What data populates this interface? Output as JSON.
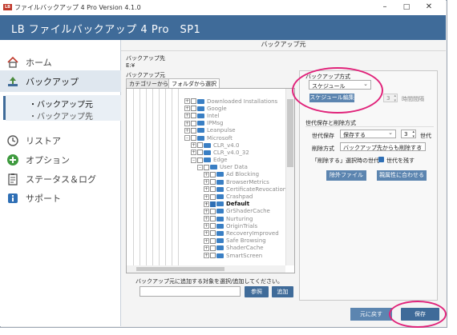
{
  "titlebar": {
    "title": "ファイルバックアップ 4 Pro Version 4.1.0",
    "logo_text": "LB",
    "min": "–",
    "max": "□",
    "close": "✕"
  },
  "header": {
    "title": "LB ファイルバックアップ 4 Pro　SP1"
  },
  "sidebar": {
    "home": "ホーム",
    "backup": "バックアップ",
    "sub_source": "・バックアップ元",
    "sub_dest": "・バックアップ先",
    "restore": "リストア",
    "options": "オプション",
    "status": "ステータス＆ログ",
    "support": "サポート"
  },
  "page": {
    "title": "バックアップ元"
  },
  "dest": {
    "label": "バックアップ先",
    "value": "E:¥"
  },
  "source": {
    "label": "バックアップ元",
    "tab_category": "カテゴリーから選択",
    "tab_folder": "フォルダから選択",
    "add_prompt": "バックアップ元に追加する対象を選択/追加してください。",
    "browse_button": "参照",
    "add_button": "追加"
  },
  "tree": [
    {
      "label": "Downloaded Installations",
      "level": 0,
      "toggle": "+",
      "checked": false
    },
    {
      "label": "Google",
      "level": 0,
      "toggle": "+",
      "checked": false
    },
    {
      "label": "Intel",
      "level": 0,
      "toggle": "+",
      "checked": false
    },
    {
      "label": "IPMsg",
      "level": 0,
      "toggle": "+",
      "checked": false
    },
    {
      "label": "Leanpulse",
      "level": 0,
      "toggle": "+",
      "checked": false
    },
    {
      "label": "Microsoft",
      "level": 0,
      "toggle": "–",
      "checked": false
    },
    {
      "label": "CLR_v4.0",
      "level": 1,
      "toggle": "+",
      "checked": false
    },
    {
      "label": "CLR_v4.0_32",
      "level": 1,
      "toggle": "+",
      "checked": false
    },
    {
      "label": "Edge",
      "level": 1,
      "toggle": "–",
      "checked": false
    },
    {
      "label": "User Data",
      "level": 2,
      "toggle": "–",
      "checked": false
    },
    {
      "label": "Ad Blocking",
      "level": 3,
      "toggle": "+",
      "checked": false
    },
    {
      "label": "BrowserMetrics",
      "level": 3,
      "toggle": "+",
      "checked": false
    },
    {
      "label": "CertificateRevocation",
      "level": 3,
      "toggle": "+",
      "checked": false
    },
    {
      "label": "Crashpad",
      "level": 3,
      "toggle": "+",
      "checked": false
    },
    {
      "label": "Default",
      "level": 3,
      "toggle": "+",
      "checked": true,
      "selected": true
    },
    {
      "label": "GrShaderCache",
      "level": 3,
      "toggle": "+",
      "checked": false
    },
    {
      "label": "Nurturing",
      "level": 3,
      "toggle": "+",
      "checked": false
    },
    {
      "label": "OriginTrials",
      "level": 3,
      "toggle": "+",
      "checked": false
    },
    {
      "label": "RecoveryImproved",
      "level": 3,
      "toggle": "+",
      "checked": false
    },
    {
      "label": "Safe Browsing",
      "level": 3,
      "toggle": "+",
      "checked": false
    },
    {
      "label": "ShaderCache",
      "level": 3,
      "toggle": "+",
      "checked": false
    },
    {
      "label": "SmartScreen",
      "level": 3,
      "toggle": "+",
      "checked": false
    }
  ],
  "method": {
    "label": "バックアップ方式",
    "select_value": "スケジュール",
    "edit_button": "スケジュール編集",
    "interval_value": "3",
    "interval_label": "時間間隔"
  },
  "generation": {
    "label": "世代保存と削除方式",
    "save_label": "世代保存",
    "save_value": "保存する",
    "count_value": "3",
    "count_unit": "世代",
    "delete_label": "削除方式",
    "delete_value": "バックアップ先からも削除する",
    "keep_label": "「削除する」選択時の世代",
    "keep_check_label": "世代を残す",
    "exclude_button": "除外ファイル",
    "ownership_button": "親属性に合わせる"
  },
  "footer": {
    "restore_button": "元に戻す",
    "save_button": "保存"
  },
  "colors": {
    "accent": "#3f6b99",
    "highlight": "#e0237a",
    "folder": "#3a7fc4"
  }
}
